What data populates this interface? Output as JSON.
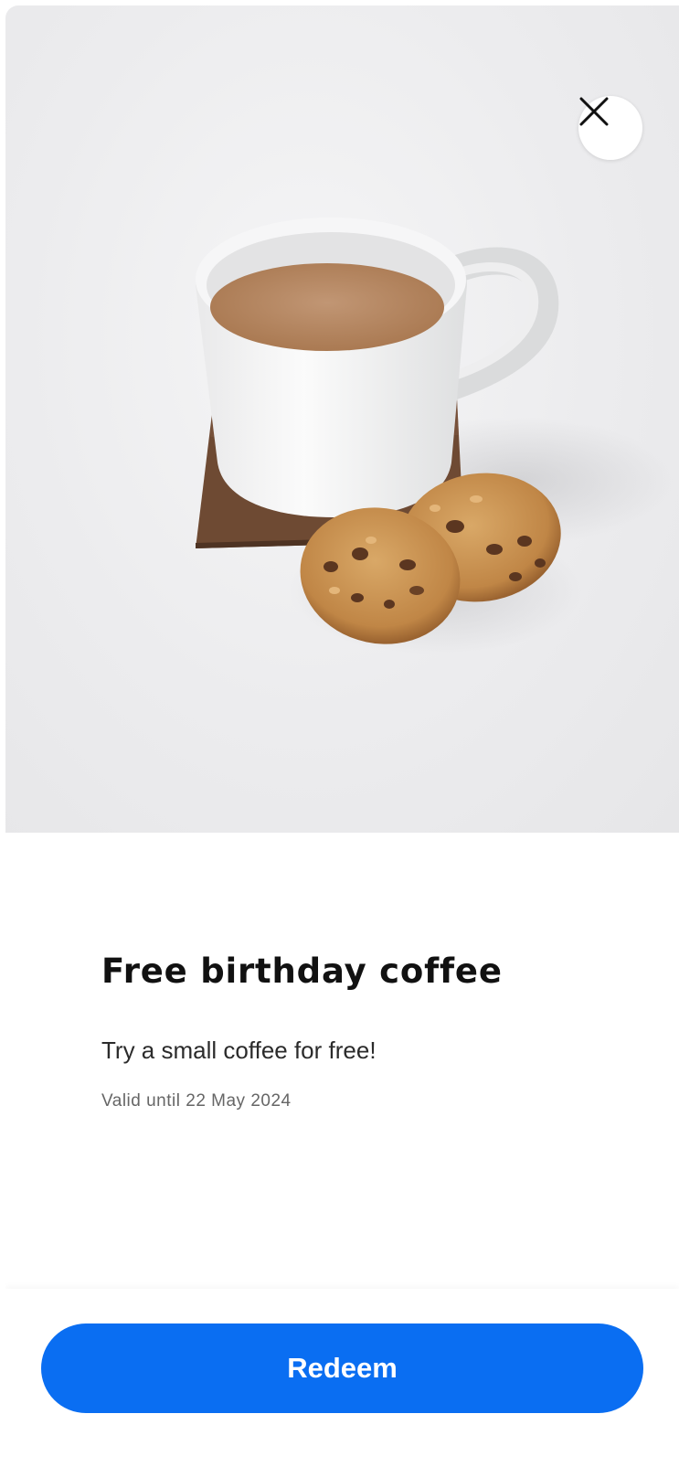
{
  "offer": {
    "title": "Free birthday coffee",
    "description": "Try a small coffee for free!",
    "validity": "Valid until 22 May 2024"
  },
  "actions": {
    "redeem_label": "Redeem",
    "close_icon": "close-icon"
  },
  "image": {
    "subject": "coffee-mug-with-cookies"
  },
  "colors": {
    "accent": "#0a6ef2",
    "title_text": "#111111",
    "secondary_text": "#666666"
  }
}
